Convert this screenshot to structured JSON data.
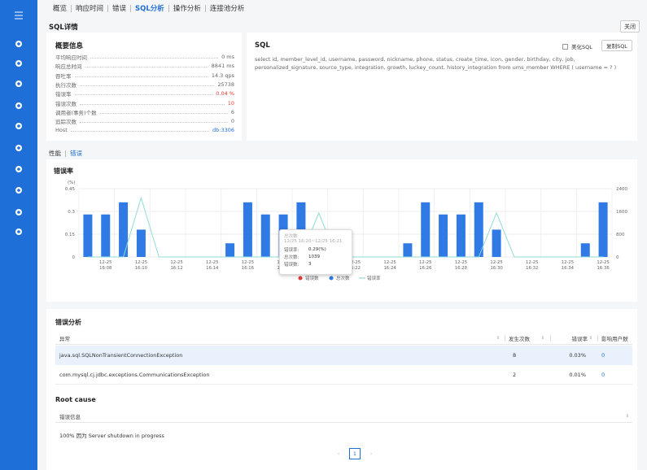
{
  "sidebar": {
    "icons": [
      "menu-toggle-icon",
      "drop-icon",
      "chart-icon",
      "eye-icon",
      "user-icon",
      "target-icon",
      "cluster-icon",
      "fire-icon",
      "mobile-icon",
      "tool-icon",
      "play-icon"
    ]
  },
  "tabs": [
    "概览",
    "响应时间",
    "错误",
    "SQL分析",
    "操作分析",
    "连接池分析"
  ],
  "active_tab": "SQL分析",
  "page_title": "SQL详情",
  "close_label": "关闭",
  "overview": {
    "title": "概要信息",
    "items": [
      {
        "k": "平均响应时间",
        "v": "0 ms"
      },
      {
        "k": "响应总时间",
        "v": "8841 ms"
      },
      {
        "k": "吞吐率",
        "v": "14.3 qps"
      },
      {
        "k": "执行次数",
        "v": "25738"
      },
      {
        "k": "错误率",
        "v": "0.04 %"
      },
      {
        "k": "错误次数",
        "v": "10"
      },
      {
        "k": "调用者(事务)个数",
        "v": "6"
      },
      {
        "k": "追踪次数",
        "v": "0"
      },
      {
        "k": "Host",
        "v": "db:3306"
      }
    ]
  },
  "sql": {
    "title": "SQL",
    "beautify_label": "美化SQL",
    "copy_label": "复制SQL",
    "text": "select id, member_level_id, username, password, nickname, phone, status, create_time, icon, gender, birthday, city, job, personalized_signature, source_type, integration, growth, luckey_count, history_integration from ums_member WHERE ( username = ? )"
  },
  "subtabs": [
    "性能",
    "错误"
  ],
  "active_subtab": "错误",
  "chart_card_title": "错误率",
  "colors": {
    "error": "#e53935",
    "total": "#2f7ae5",
    "rate": "#8fdcd6",
    "brand": "#1f6fd8"
  },
  "chart_data": {
    "type": "bar",
    "title": "错误率",
    "ylabel": "(%)",
    "left_ylim": [
      0,
      0.45
    ],
    "left_ticks": [
      "0",
      "0.15",
      "0.3",
      "0.45"
    ],
    "right_ylim": [
      0,
      2400
    ],
    "right_ticks": [
      "0",
      "800",
      "1600",
      "2400"
    ],
    "categories": [
      "12-25 16:07",
      "12-25 16:08",
      "12-25 16:09",
      "12-25 16:10",
      "12-25 16:11",
      "12-25 16:12",
      "12-25 16:13",
      "12-25 16:14",
      "12-25 16:15",
      "12-25 16:16",
      "12-25 16:17",
      "12-25 16:18",
      "12-25 16:19",
      "12-25 16:20",
      "12-25 16:21",
      "12-25 16:22",
      "12-25 16:23",
      "12-25 16:24",
      "12-25 16:25",
      "12-25 16:26",
      "12-25 16:27",
      "12-25 16:28",
      "12-25 16:29",
      "12-25 16:30",
      "12-25 16:31",
      "12-25 16:32",
      "12-25 16:33",
      "12-25 16:34",
      "12-25 16:35",
      "12-25 16:36"
    ],
    "x_labels": [
      "12-25\n16:08",
      "12-25\n16:10",
      "12-25\n16:12",
      "12-25\n16:14",
      "12-25\n16:16",
      "12-25\n16:18",
      "12-25\n16:20",
      "12-25\n16:22",
      "12-25\n16:24",
      "12-25\n16:26",
      "12-25\n16:28",
      "12-25\n16:30",
      "12-25\n16:32",
      "12-25\n16:34",
      "12-25\n16:36"
    ],
    "series": [
      {
        "name": "错误数",
        "type": "bar",
        "axis": "left",
        "values": [
          0,
          0,
          0,
          0,
          0,
          0,
          0,
          0,
          0,
          0,
          0,
          0,
          0,
          0,
          0,
          0,
          0,
          0,
          0,
          0,
          0,
          0,
          0,
          0,
          0,
          0,
          0,
          0,
          0,
          0
        ]
      },
      {
        "name": "总次数",
        "type": "bar",
        "axis": "left",
        "values": [
          0.28,
          0.28,
          0.36,
          0.18,
          0,
          0,
          0,
          0,
          0.09,
          0.36,
          0.28,
          0.28,
          0.36,
          0.14,
          0,
          0,
          0,
          0,
          0.09,
          0.36,
          0.28,
          0.28,
          0.36,
          0.18,
          0,
          0,
          0,
          0,
          0.09,
          0.36
        ]
      },
      {
        "name": "错误率",
        "type": "line",
        "axis": "left",
        "values": [
          0,
          0,
          0,
          0.39,
          0,
          0,
          0,
          0,
          0,
          0,
          0,
          0,
          0,
          0.29,
          0,
          0,
          0,
          0,
          0,
          0,
          0,
          0,
          0,
          0.29,
          0,
          0,
          0,
          0,
          0,
          0
        ]
      }
    ],
    "legend": "bottom",
    "tooltip": {
      "header": "总次数",
      "range": "12/25 16:20~12/25 16:21",
      "rows": [
        {
          "l": "错误率:",
          "v": "0.29(%)"
        },
        {
          "l": "总次数:",
          "v": "1039"
        },
        {
          "l": "错误数:",
          "v": "3"
        }
      ]
    }
  },
  "errors": {
    "title": "错误分析",
    "columns": [
      "异常",
      "发生次数",
      "错误率",
      "影响用户数"
    ],
    "rows": [
      {
        "ex": "java.sql.SQLNonTransientConnectionException",
        "count": "8",
        "rate": "0.03%",
        "users": "0"
      },
      {
        "ex": "com.mysql.cj.jdbc.exceptions.CommunicationsException",
        "count": "2",
        "rate": "0.01%",
        "users": "0"
      }
    ]
  },
  "root_cause": {
    "title": "Root cause",
    "column": "错误信息",
    "rows": [
      "100% 因为 Server shutdown in progress"
    ]
  },
  "pager": {
    "prev": "‹",
    "current": "1",
    "next": "›"
  }
}
